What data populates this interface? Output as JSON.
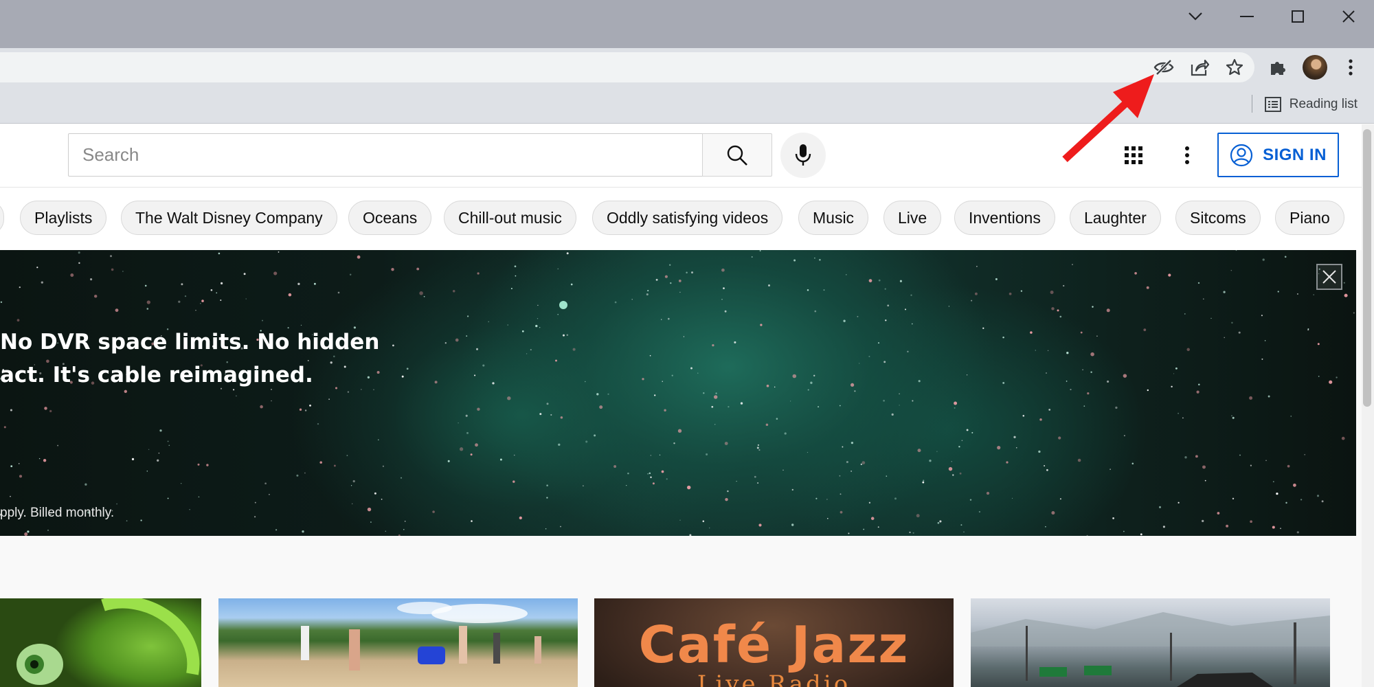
{
  "browser": {
    "window_controls": {
      "tabsearch_icon": "chevron-down",
      "minimize_icon": "minimize",
      "maximize_icon": "maximize",
      "close_icon": "close"
    },
    "toolbar_icons": [
      "eye-slash",
      "share",
      "star",
      "puzzle",
      "avatar",
      "kebab"
    ],
    "reading_list_label": "Reading list"
  },
  "youtube": {
    "search": {
      "placeholder": "Search"
    },
    "signin_label": "SIGN IN",
    "chips": [
      "Playlists",
      "The Walt Disney Company",
      "Oceans",
      "Chill-out music",
      "Oddly satisfying videos",
      "Music",
      "Live",
      "Inventions",
      "Laughter",
      "Sitcoms",
      "Piano"
    ],
    "banner": {
      "line1": "No DVR space limits. No hidden",
      "line2": "act. It's cable reimagined.",
      "fine_print": "pply. Billed monthly."
    },
    "thumbnails": {
      "cafe_title": "Café Jazz",
      "cafe_subtitle": "Live Radio"
    }
  },
  "colors": {
    "accent_blue": "#065fd4",
    "annotation_red": "#ee1c1c"
  }
}
